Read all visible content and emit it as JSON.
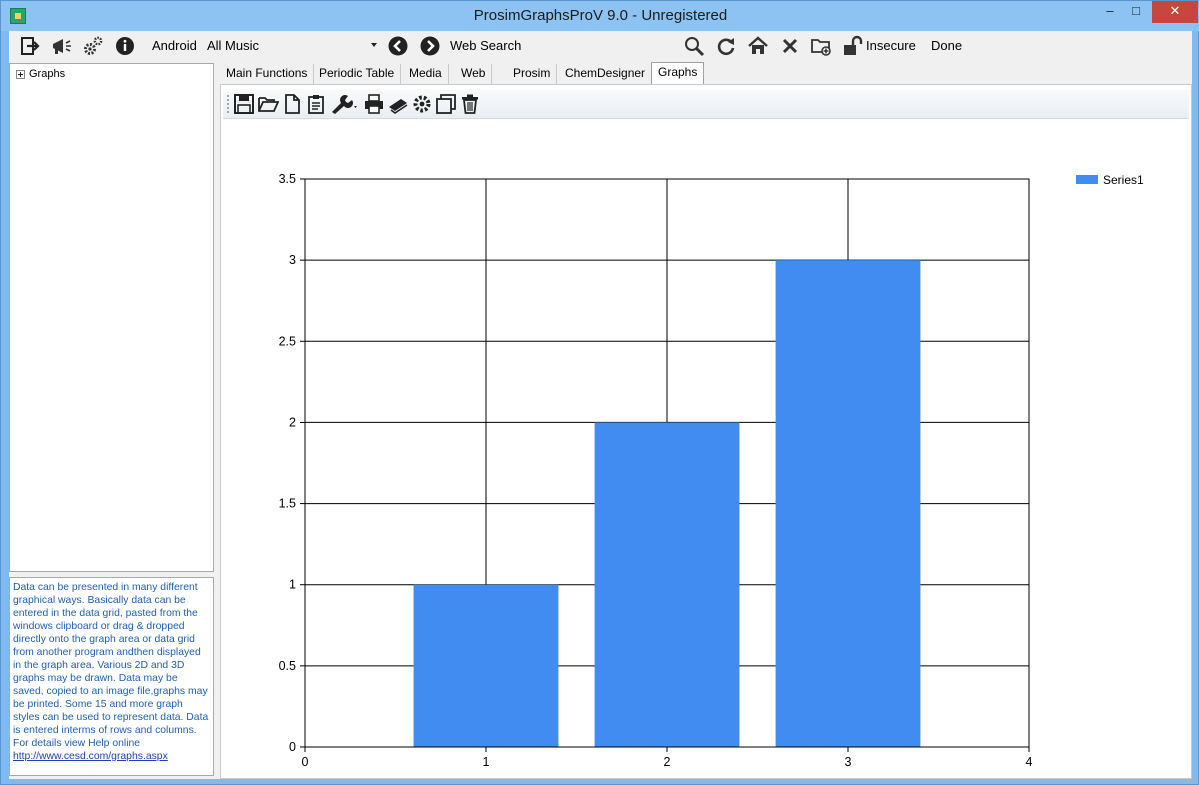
{
  "window": {
    "title": "ProsimGraphsProV 9.0 - Unregistered",
    "min_glyph": "–",
    "max_glyph": "□",
    "close_glyph": "✕"
  },
  "toolbar": {
    "icons": [
      "exit-icon",
      "megaphone-icon",
      "gears-icon",
      "info-icon"
    ],
    "android_label": "Android",
    "combo_value": "All Music",
    "nav_icons": [
      "back-icon",
      "forward-icon"
    ],
    "web_search_label": "Web Search",
    "right_icons": [
      "search-icon",
      "refresh-icon",
      "home-icon",
      "close-icon",
      "new-folder-icon",
      "lock-icon"
    ],
    "insecure_label": "Insecure",
    "done_label": "Done"
  },
  "tree": {
    "items": [
      {
        "label": "Graphs"
      }
    ]
  },
  "description": {
    "text": "Data can be presented in many different graphical ways. Basically data can be entered in the data grid, pasted from the windows clipboard or drag & dropped directly onto the graph area or data grid from another program andthen displayed in the graph area. Various 2D and 3D graphs may be drawn. Data may be saved, copied to an image file,graphs may be printed. Some 15 and more graph styles can be used to represent data. Data is entered interms of rows and columns. For details view Help online",
    "link": "http://www.cesd.com/graphs.aspx"
  },
  "tabs": [
    {
      "label": "Main Functions"
    },
    {
      "label": "Periodic Table"
    },
    {
      "label": "Media"
    },
    {
      "label": "Web"
    },
    {
      "label": "Prosim"
    },
    {
      "label": "ChemDesigner"
    },
    {
      "label": "Graphs",
      "active": true
    }
  ],
  "graph_toolbar": {
    "icons": [
      "save-icon",
      "open-folder-icon",
      "new-document-icon",
      "clipboard-icon",
      "wrench-icon",
      "print-icon",
      "scanner-icon",
      "settings-icon",
      "copy-icon",
      "trash-icon"
    ]
  },
  "colors": {
    "bar": "#418cf0",
    "grid": "#000000",
    "accent": "#2c6fc6"
  },
  "chart_data": {
    "type": "bar",
    "x": [
      1,
      2,
      3
    ],
    "series": [
      {
        "name": "Series1",
        "values": [
          1,
          2,
          3
        ]
      }
    ],
    "xlim": [
      0,
      4
    ],
    "ylim": [
      0,
      3.5
    ],
    "xticks": [
      "0",
      "1",
      "2",
      "3",
      "4"
    ],
    "yticks": [
      "0",
      "0.5",
      "1",
      "1.5",
      "2",
      "2.5",
      "3",
      "3.5"
    ],
    "grid": true,
    "legend_position": "top-right"
  }
}
